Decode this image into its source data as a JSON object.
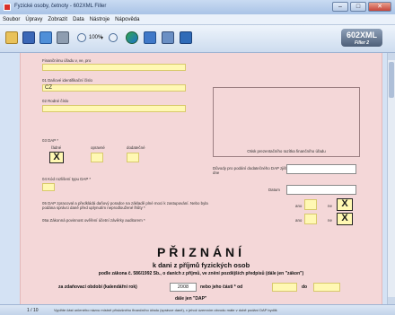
{
  "window": {
    "title": "Fyzické osoby, četnoty - 602XML Filler",
    "minimize": "–",
    "maximize": "□",
    "close": "✕"
  },
  "menu": [
    "Soubor",
    "Úpravy",
    "Zobrazit",
    "Data",
    "Nástroje",
    "Nápověda"
  ],
  "toolbar": {
    "zoom": "100%",
    "zoom_dropdown": "▾",
    "logo_main": "602XML",
    "logo_sub": "Filler 2"
  },
  "form": {
    "fu_label": "Finančnímu úřadu v, ve, pro",
    "f01_label": "01 Daňové identifikační číslo",
    "f01_value": "CZ",
    "f02_label": "02 Rodné číslo",
    "stamp_label": "Otisk prezentačního razítka finančního úřadu",
    "f03_label": "03 DAP *",
    "dap_types": [
      "řádné",
      "opravné",
      "dodatečné"
    ],
    "dap_mark": "X",
    "duvody_label": "Důvody pro podání dodatečného DAP zjištěny dne",
    "f04_label": "04 Kód rozlišení typu DAP *",
    "datum_label": "Datum",
    "f05_label": "05 DAP zpracoval a předkládá daňový poradce na základě plné moci k zastupování. Nebo byla podána správci daně před uplynutím neprodloužené lhůty *",
    "f05a_label": "05a Zákonná povinnost ověření účetní závěrky auditorem *",
    "ano": "ano",
    "ne": "ne",
    "ne_mark": "X",
    "title": "PŘIZNÁNÍ",
    "subtitle": "k dani z příjmů fyzických osob",
    "law": "podle zákona č. 586/1992 Sb., o daních z příjmů, ve znění pozdějších předpisů (dále jen \"zákon\")",
    "period_label": "za zdaňovací období (kalendářní rok)",
    "year": "2008",
    "period_part": "nebo jeho části * od",
    "period_to": "do",
    "dap_short": "dále jen \"DAP\""
  },
  "status": {
    "page": "1 / 10",
    "hint": "Vyplňte část určeného názvu místně příslušného finančního úřadu (správce daně), v jehož územním obvodu máte v době podání DAP bydliš"
  }
}
